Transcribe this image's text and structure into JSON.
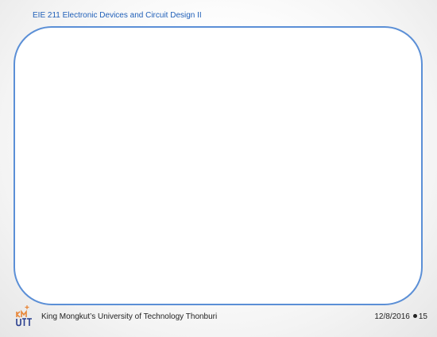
{
  "slide": {
    "header_title": "EIE 211 Electronic Devices and Circuit Design II",
    "footer": {
      "university": "King Mongkut’s University of Technology Thonburi",
      "date": "12/8/2016",
      "page_number": "15"
    },
    "logo": {
      "text": "KMUTT",
      "colors": {
        "primary": "#e8873a",
        "secondary": "#2a3f8f"
      }
    }
  },
  "colors": {
    "title": "#1f5fb8",
    "frame_border": "#5b8fd6",
    "text": "#222222"
  }
}
